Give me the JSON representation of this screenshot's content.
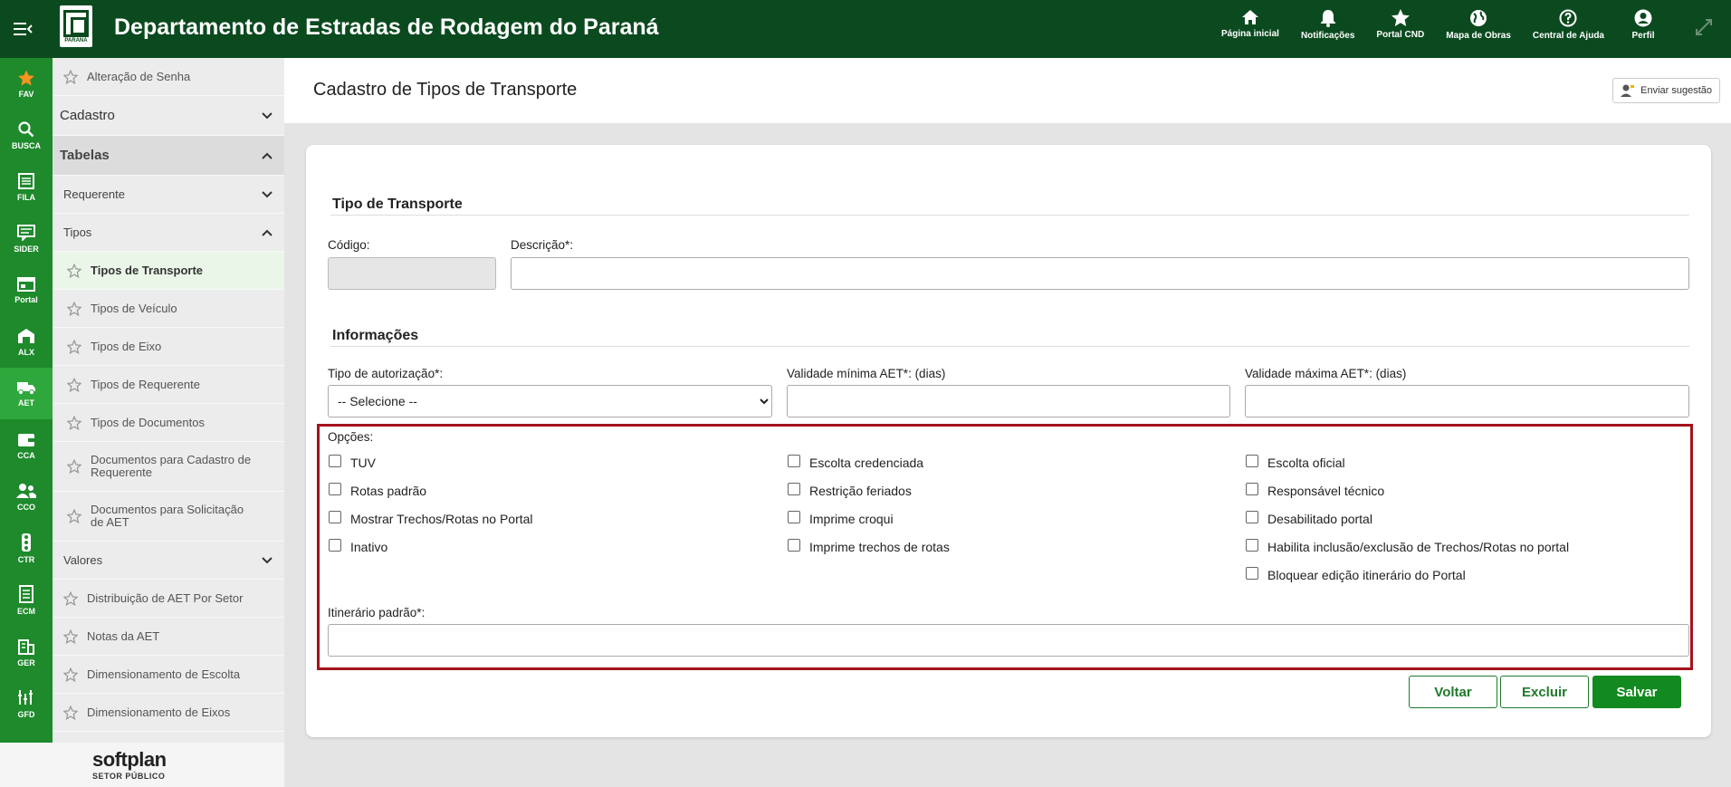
{
  "header": {
    "app_title": "Departamento de Estradas de Rodagem do Paraná",
    "logo_text": "PARANÁ",
    "nav": [
      {
        "label": "Página inicial",
        "icon": "home-icon"
      },
      {
        "label": "Notificações",
        "icon": "bell-icon"
      },
      {
        "label": "Portal CND",
        "icon": "star-icon"
      },
      {
        "label": "Mapa de Obras",
        "icon": "globe-icon"
      },
      {
        "label": "Central de Ajuda",
        "icon": "help-icon"
      },
      {
        "label": "Perfil",
        "icon": "user-icon"
      }
    ]
  },
  "iconbar": [
    {
      "label": "FAV",
      "icon": "star-icon"
    },
    {
      "label": "BUSCA",
      "icon": "search-icon"
    },
    {
      "label": "FILA",
      "icon": "list-icon"
    },
    {
      "label": "SIDER",
      "icon": "message-icon"
    },
    {
      "label": "Portal",
      "icon": "portal-icon"
    },
    {
      "label": "ALX",
      "icon": "warehouse-icon"
    },
    {
      "label": "AET",
      "icon": "truck-icon"
    },
    {
      "label": "CCA",
      "icon": "wallet-icon"
    },
    {
      "label": "CCO",
      "icon": "users-icon"
    },
    {
      "label": "CTR",
      "icon": "traffic-light-icon"
    },
    {
      "label": "ECM",
      "icon": "document-icon"
    },
    {
      "label": "GER",
      "icon": "building-icon"
    },
    {
      "label": "GFD",
      "icon": "chart-icon"
    }
  ],
  "menu": {
    "alteracao_senha": "Alteração de Senha",
    "cadastro": "Cadastro",
    "tabelas": "Tabelas",
    "requerente": "Requerente",
    "tipos": "Tipos",
    "tipos_items": [
      "Tipos de Transporte",
      "Tipos de Veículo",
      "Tipos de Eixo",
      "Tipos de Requerente",
      "Tipos de Documentos",
      "Documentos para Cadastro de Requerente",
      "Documentos para Solicitação de AET"
    ],
    "valores": "Valores",
    "valores_items": [
      "Distribuição de AET Por Setor",
      "Notas da AET",
      "Dimensionamento de Escolta",
      "Dimensionamento de Eixos"
    ]
  },
  "footer": {
    "brand": "softplan",
    "subtitle": "SETOR PÚBLICO"
  },
  "page": {
    "title": "Cadastro de Tipos de Transporte",
    "suggestion_button": "Enviar sugestão"
  },
  "form": {
    "section_tipo": "Tipo de Transporte",
    "codigo_label": "Código:",
    "descricao_label": "Descrição*:",
    "section_info": "Informações",
    "tipo_autorizacao_label": "Tipo de autorização*:",
    "tipo_autorizacao_value": "-- Selecione --",
    "validade_min_label": "Validade mínima AET*: (dias)",
    "validade_max_label": "Validade máxima AET*: (dias)",
    "opcoes_label": "Opções:",
    "options_col1": [
      "TUV",
      "Rotas padrão",
      "Mostrar Trechos/Rotas no Portal",
      "Inativo"
    ],
    "options_col2": [
      "Escolta credenciada",
      "Restrição feriados",
      "Imprime croqui",
      "Imprime trechos de rotas"
    ],
    "options_col3": [
      "Escolta oficial",
      "Responsável técnico",
      "Desabilitado portal",
      "Habilita inclusão/exclusão de Trechos/Rotas no portal",
      "Bloquear edição itinerário do Portal"
    ],
    "itinerario_label": "Itinerário padrão*:"
  },
  "actions": {
    "voltar": "Voltar",
    "excluir": "Excluir",
    "salvar": "Salvar"
  },
  "colors": {
    "header_bg": "#0b4a1f",
    "iconbar_bg": "#1e8a2c",
    "highlight_border": "#a5121c",
    "primary_button": "#138a1f"
  }
}
